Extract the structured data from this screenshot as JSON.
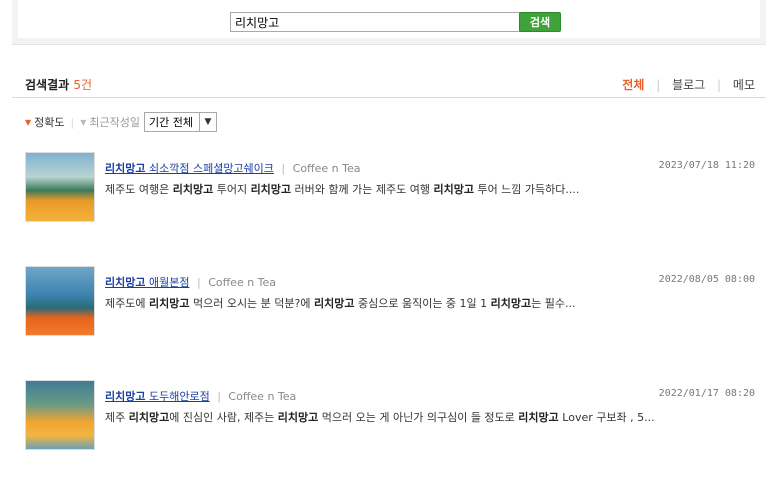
{
  "search": {
    "query": "리치망고",
    "button_label": "검색"
  },
  "results_header": {
    "label": "검색결과",
    "count": "5건"
  },
  "filter_tabs": [
    {
      "label": "전체",
      "active": true
    },
    {
      "label": "블로그",
      "active": false
    },
    {
      "label": "메모",
      "active": false
    }
  ],
  "sort": {
    "accuracy_label": "정확도",
    "recent_label": "최근작성일",
    "period_value": "기간 전체"
  },
  "colors": {
    "accent": "#e8632b",
    "link": "#1a3fa3",
    "search_button": "#3fa33a"
  },
  "results": [
    {
      "title_bold": "리치망고",
      "title_rest": " 쇠소깍점 스페셜망고쉐이크",
      "category": "Coffee n Tea",
      "date": "2023/07/18 11:20",
      "snippet": [
        {
          "t": "제주도 여행은 ",
          "b": false
        },
        {
          "t": "리치망고",
          "b": true
        },
        {
          "t": " 투어지 ",
          "b": false
        },
        {
          "t": "리치망고",
          "b": true
        },
        {
          "t": " 러버와 함께 가는 제주도 여행 ",
          "b": false
        },
        {
          "t": "리치망고",
          "b": true
        },
        {
          "t": " 투어 느낌 가득하다....",
          "b": false
        }
      ]
    },
    {
      "title_bold": "리치망고",
      "title_rest": " 애월본점",
      "category": "Coffee n Tea",
      "date": "2022/08/05 08:00",
      "snippet": [
        {
          "t": "제주도에 ",
          "b": false
        },
        {
          "t": "리치망고",
          "b": true
        },
        {
          "t": " 먹으러 오시는 분 덕분?에 ",
          "b": false
        },
        {
          "t": "리치망고",
          "b": true
        },
        {
          "t": " 중심으로 움직이는 중 1일 1 ",
          "b": false
        },
        {
          "t": "리치망고",
          "b": true
        },
        {
          "t": "는 필수...",
          "b": false
        }
      ]
    },
    {
      "title_bold": "리치망고",
      "title_rest": " 도두해안로점",
      "category": "Coffee n Tea",
      "date": "2022/01/17 08:20",
      "snippet": [
        {
          "t": "제주 ",
          "b": false
        },
        {
          "t": "리치망고",
          "b": true
        },
        {
          "t": "에 진심인 사람, 제주는 ",
          "b": false
        },
        {
          "t": "리치망고",
          "b": true
        },
        {
          "t": " 먹으러 오는 게 아닌가 의구심이 들 정도로 ",
          "b": false
        },
        {
          "t": "리치망고",
          "b": true
        },
        {
          "t": " Lover 구보좌 , 5...",
          "b": false
        }
      ]
    }
  ]
}
